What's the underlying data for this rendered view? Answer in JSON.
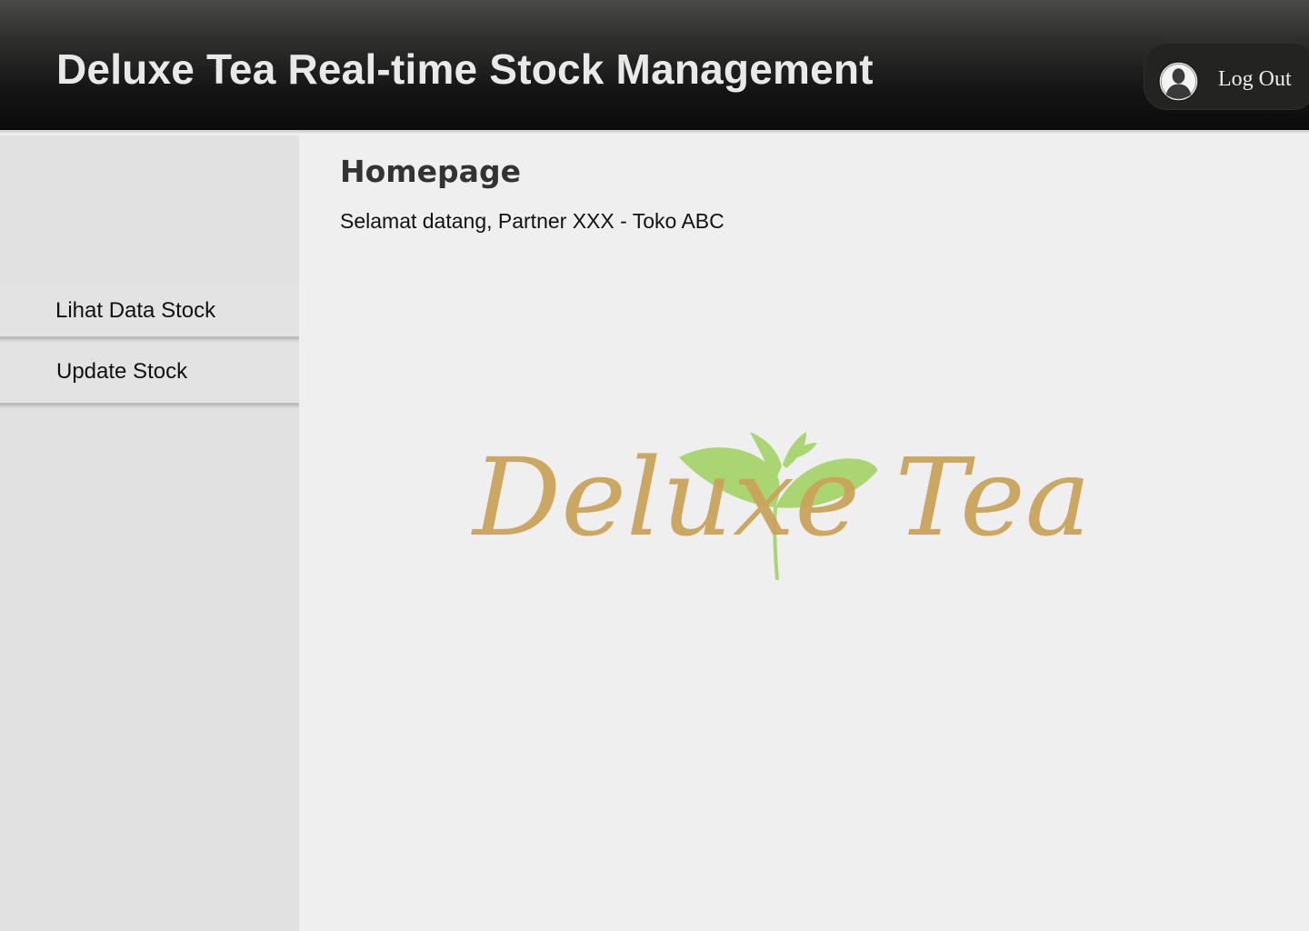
{
  "header": {
    "title": "Deluxe Tea Real-time Stock Management",
    "logout_label": "Log Out",
    "user_icon": "user-avatar-icon"
  },
  "sidebar": {
    "items": [
      {
        "label": "Lihat Data Stock"
      },
      {
        "label": "Update Stock"
      }
    ]
  },
  "main": {
    "page_title": "Homepage",
    "welcome": "Selamat datang, Partner XXX - Toko ABC",
    "logo_text": "Deluxe Tea"
  },
  "colors": {
    "header_dark": "#0b0b0b",
    "header_light": "#4a4a49",
    "sidebar_bg": "#e1e1e1",
    "main_bg": "#efefef",
    "logo_gold": "#c9a25a",
    "logo_leaf": "#a9d672"
  }
}
